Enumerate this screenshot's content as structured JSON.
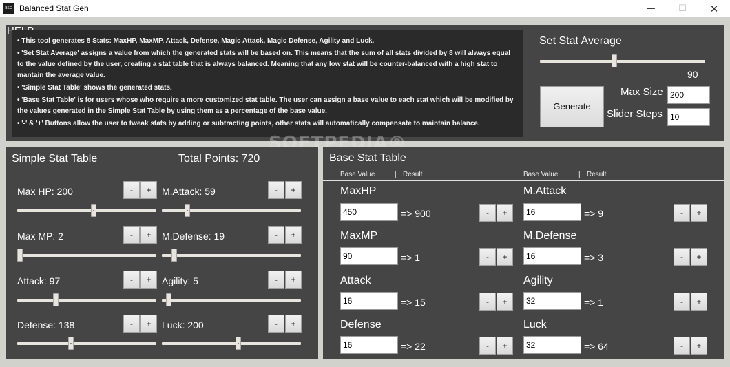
{
  "window": {
    "icon_text": "BSG",
    "title": "Balanced Stat Gen",
    "minimize": "—",
    "maximize": "☐",
    "close": "✕"
  },
  "help": {
    "title": "HELP",
    "lines": [
      "• This tool generates 8 Stats: MaxHP, MaxMP, Attack, Defense, Magic Attack, Magic Defense, Agility and Luck.",
      "• 'Set Stat Average' assigns a value from which the generated stats will be based on. This means that the sum of all stats divided by 8 will always equal to the value defined by the user, creating a stat table that is always balanced. Meaning that any low stat will be counter-balanced with a high stat to mantain the average value.",
      "• 'Simple Stat Table' shows the generated stats.",
      "• 'Base Stat Table' is for users whose who require a more customized stat table. The user can assign a base value to each stat which will be modified by the values generated in the Simple Stat Table by using them as a percentage of the base value.",
      "• '-' & '+' Buttons allow the user to tweak stats by adding or subtracting points, other stats will automatically compensate  to maintain balance."
    ]
  },
  "set_stat_average": {
    "label": "Set Stat Average",
    "value": "90",
    "slider_fraction": 0.45,
    "generate_label": "Generate",
    "max_size_label": "Max Size",
    "max_size_value": "200",
    "slider_steps_label": "Slider Steps",
    "slider_steps_value": "10"
  },
  "watermark": "SOFTPEDIA®",
  "simple_table": {
    "title": "Simple Stat Table",
    "total_points": "Total Points: 720",
    "minus": "-",
    "plus": "+",
    "stats": [
      {
        "label": "Max HP: 200",
        "fraction": 0.55
      },
      {
        "label": "M.Attack: 59",
        "fraction": 0.17
      },
      {
        "label": "Max MP: 2",
        "fraction": 0.0
      },
      {
        "label": "M.Defense: 19",
        "fraction": 0.07
      },
      {
        "label": "Attack: 97",
        "fraction": 0.27
      },
      {
        "label": "Agility: 5",
        "fraction": 0.03
      },
      {
        "label": "Defense: 138",
        "fraction": 0.38
      },
      {
        "label": "Luck: 200",
        "fraction": 0.55
      }
    ]
  },
  "base_table": {
    "title": "Base Stat Table",
    "header_base": "Base Value",
    "header_sep": "|",
    "header_result": "Result",
    "minus": "-",
    "plus": "+",
    "stats": [
      {
        "label": "MaxHP",
        "value": "450",
        "result": "=> 900"
      },
      {
        "label": "M.Attack",
        "value": "16",
        "result": "=> 9"
      },
      {
        "label": "MaxMP",
        "value": "90",
        "result": "=> 1"
      },
      {
        "label": "M.Defense",
        "value": "16",
        "result": "=> 3"
      },
      {
        "label": "Attack",
        "value": "16",
        "result": "=> 15"
      },
      {
        "label": "Agility",
        "value": "32",
        "result": "=> 1"
      },
      {
        "label": "Defense",
        "value": "16",
        "result": "=> 22"
      },
      {
        "label": "Luck",
        "value": "32",
        "result": "=> 64"
      }
    ]
  }
}
